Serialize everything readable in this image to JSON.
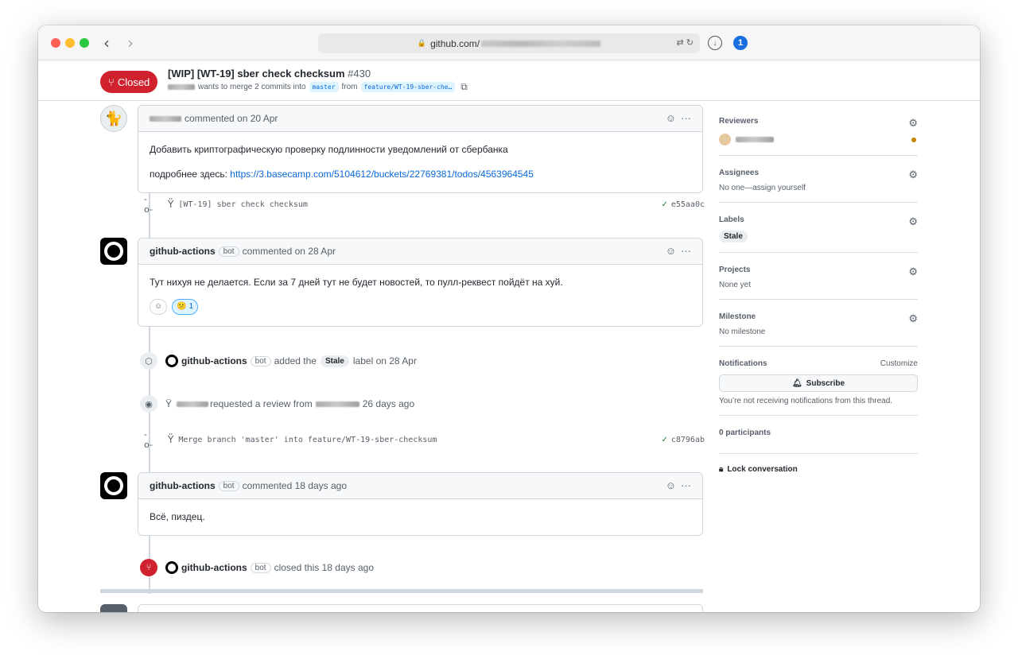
{
  "browser": {
    "url_text": "github.com/",
    "translate_icon": "translate-icon",
    "reload_icon": "reload-icon",
    "download_icon": "download-icon",
    "password_icon": "1password-icon"
  },
  "pr": {
    "state": "Closed",
    "title": "[WIP] [WT-19] sber check checksum",
    "number": "#430",
    "sub_text": "wants to merge 2 commits into",
    "base_branch": "master",
    "from_text": "from",
    "head_branch": "feature/WT-19-sber-che…"
  },
  "timeline": {
    "comment1": {
      "meta": "commented on 20 Apr",
      "line1": "Добавить криптографическую проверку подлинности уведомлений от сбербанка",
      "line2_prefix": "подробнее здесь: ",
      "link": "https://3.basecamp.com/5104612/buckets/22769381/todos/4563964545"
    },
    "commit1": {
      "message": "[WT-19] sber check checksum",
      "sha": "e55aa0c"
    },
    "comment2": {
      "author": "github-actions",
      "bot": "bot",
      "meta": "commented on 28 Apr",
      "body": "Тут нихуя не делается. Если за 7 дней тут не будет новостей, то пулл-реквест пойдёт на хуй.",
      "reaction_count": "1"
    },
    "event_label": {
      "author": "github-actions",
      "bot": "bot",
      "text1": "added the",
      "label": "Stale",
      "text2": "label on 28 Apr"
    },
    "event_review": {
      "text1": "requested a review from",
      "text2": "26 days ago"
    },
    "commit2": {
      "message": "Merge branch 'master' into feature/WT-19-sber-checksum",
      "sha": "c8796ab"
    },
    "comment3": {
      "author": "github-actions",
      "bot": "bot",
      "meta": "commented 18 days ago",
      "body": "Всё, пиздец."
    },
    "event_closed": {
      "author": "github-actions",
      "bot": "bot",
      "text": "closed this 18 days ago"
    }
  },
  "sidebar": {
    "reviewers": {
      "title": "Reviewers"
    },
    "assignees": {
      "title": "Assignees",
      "value": "No one—assign yourself"
    },
    "labels": {
      "title": "Labels",
      "label": "Stale"
    },
    "projects": {
      "title": "Projects",
      "value": "None yet"
    },
    "milestone": {
      "title": "Milestone",
      "value": "No milestone"
    },
    "notifications": {
      "title": "Notifications",
      "customize": "Customize",
      "subscribe": "Subscribe",
      "note": "You’re not receiving notifications from this thread."
    },
    "participants": "0 participants",
    "lock": "Lock conversation"
  },
  "colors": {
    "closed_red": "#cf222e",
    "link_blue": "#0969da",
    "success_green": "#1a7f37",
    "pending_yellow": "#bf8700"
  }
}
